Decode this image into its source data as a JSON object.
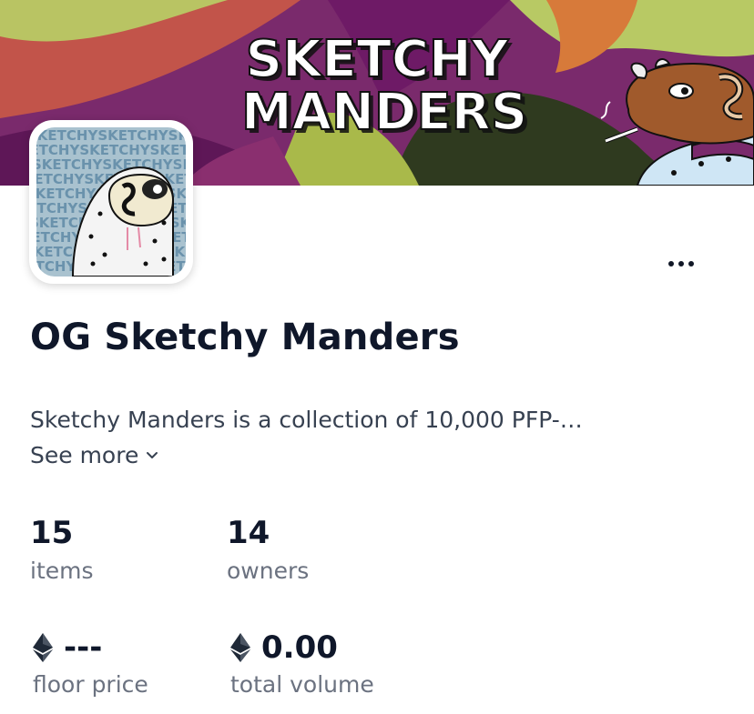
{
  "banner": {
    "title_line1": "SKETCHY",
    "title_line2": "MANDERS"
  },
  "avatar": {
    "pattern_text": "SKETCHYSKETCHYSKETCHY"
  },
  "collection": {
    "title": "OG Sketchy Manders",
    "description": "Sketchy Manders is a collection of 10,000 PFP-…",
    "see_more_label": "See more"
  },
  "stats": {
    "items": {
      "value": "15",
      "label": "items"
    },
    "owners": {
      "value": "14",
      "label": "owners"
    },
    "floor_price": {
      "value": "---",
      "label": "floor price",
      "icon": "ethereum-icon"
    },
    "total_volume": {
      "value": "0.00",
      "label": "total volume",
      "icon": "ethereum-icon"
    }
  },
  "colors": {
    "text_primary": "#0f172a",
    "text_secondary": "#6b7280",
    "banner_purple": "#6e1a66",
    "banner_red": "#c2544a",
    "banner_green": "#a9b94a",
    "banner_dark": "#2f3a1f"
  }
}
